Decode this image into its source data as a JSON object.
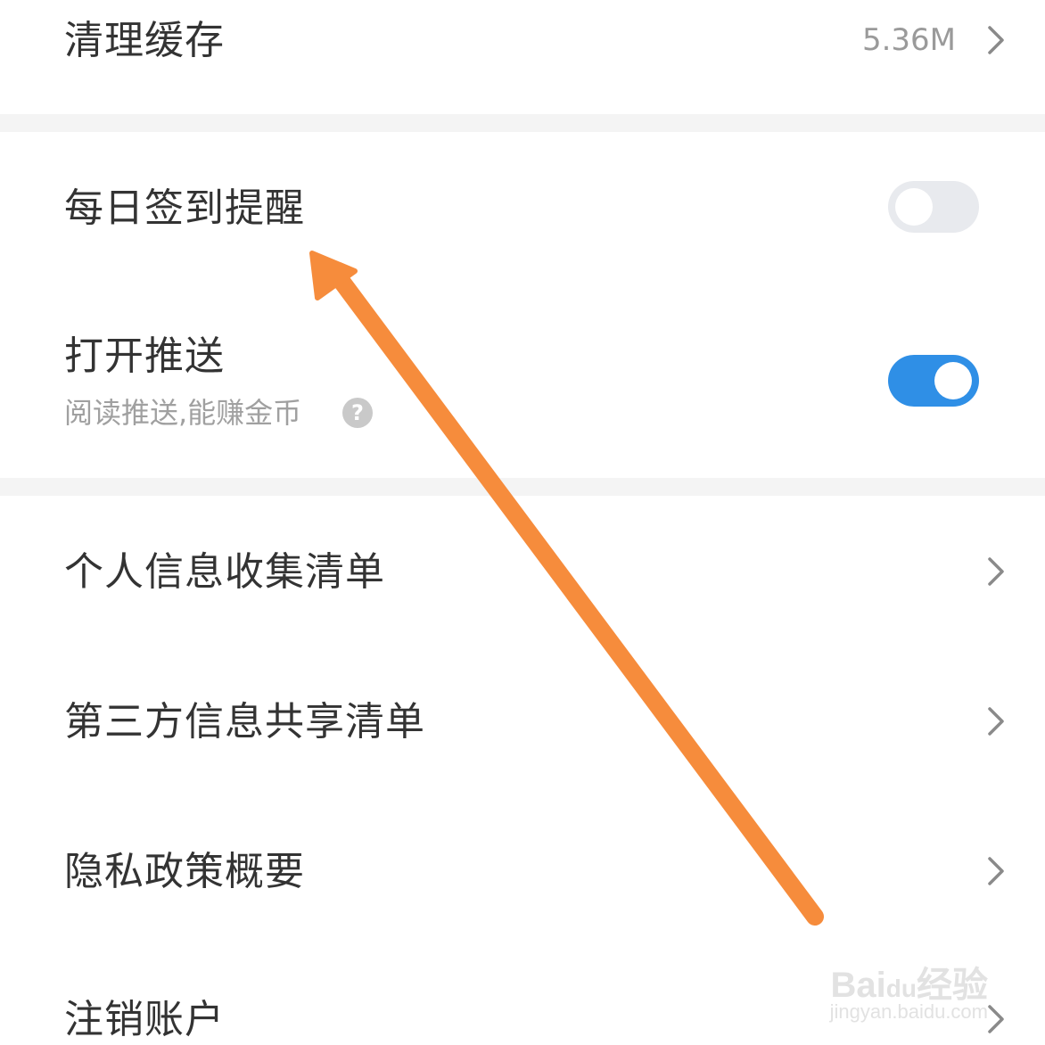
{
  "settings": {
    "clear_cache": {
      "label": "清理缓存",
      "value": "5.36M"
    },
    "daily_checkin": {
      "label": "每日签到提醒",
      "enabled": false
    },
    "push": {
      "label": "打开推送",
      "sublabel": "阅读推送,能赚金币",
      "help": "?",
      "enabled": true
    },
    "personal_info": {
      "label": "个人信息收集清单"
    },
    "third_party": {
      "label": "第三方信息共享清单"
    },
    "privacy": {
      "label": "隐私政策概要"
    },
    "cancel_account": {
      "label": "注销账户"
    }
  },
  "colors": {
    "toggle_on": "#2f8fe6",
    "toggle_off": "#e8eaee",
    "annotation_arrow": "#f68c3c"
  },
  "watermark": {
    "brand": "Bai",
    "paw": "du",
    "cn": "经验",
    "url": "jingyan.baidu.com"
  }
}
